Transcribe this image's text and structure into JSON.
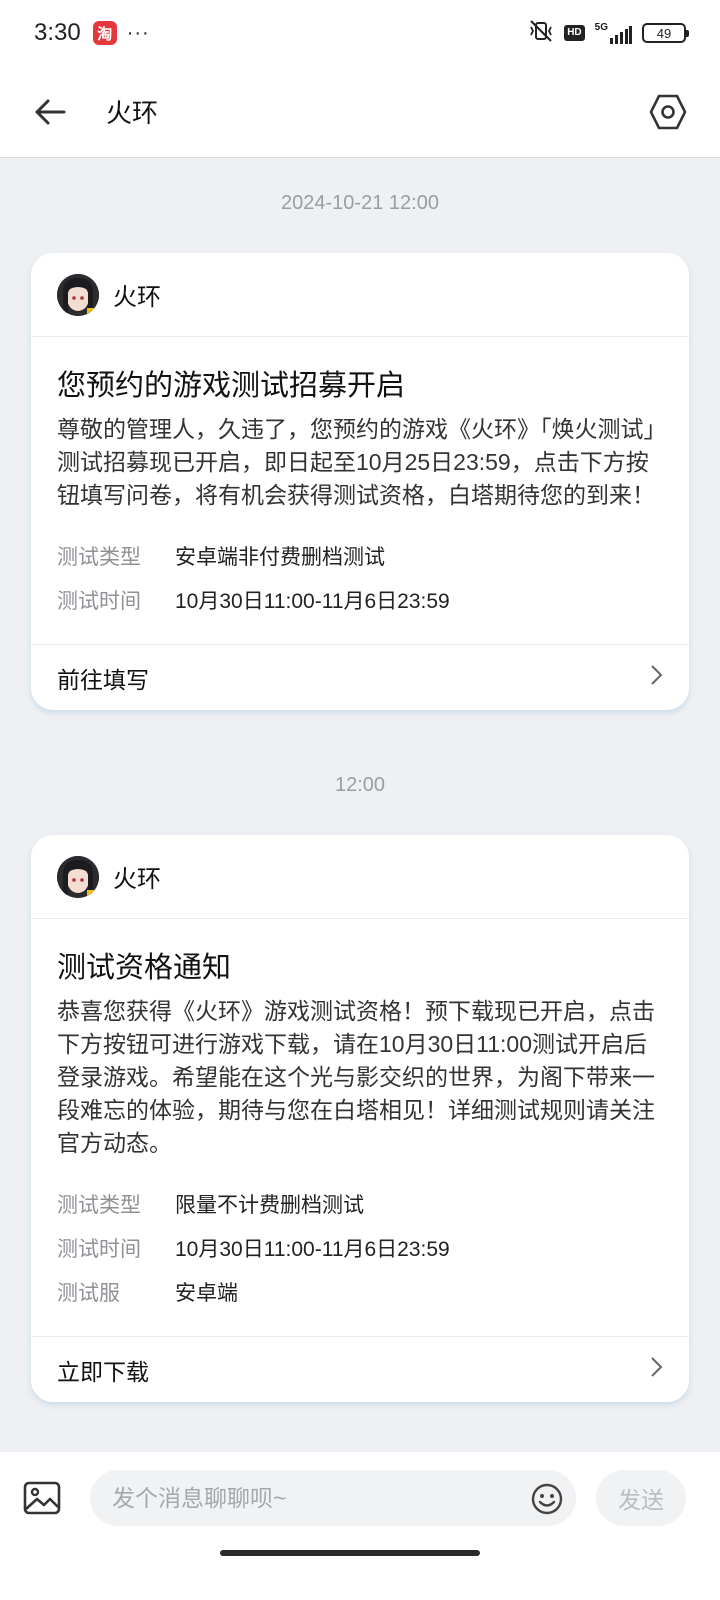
{
  "status_bar": {
    "time": "3:30",
    "taobao_label": "淘",
    "more_dots": "···",
    "hd_label": "HD",
    "network_label": "5G",
    "battery_level": "49"
  },
  "header": {
    "title": "火环",
    "back_icon": "arrow-left-icon",
    "settings_icon": "hexagon-settings-icon"
  },
  "messages": [
    {
      "timestamp": "2024-10-21 12:00",
      "sender": "火环",
      "title": "您预约的游戏测试招募开启",
      "body": "尊敬的管理人，久违了，您预约的游戏《火环》「焕火测试」测试招募现已开启，即日起至10月25日23:59，点击下方按钮填写问卷，将有机会获得测试资格，白塔期待您的到来！",
      "meta": [
        {
          "key": "测试类型",
          "value": "安卓端非付费删档测试"
        },
        {
          "key": "测试时间",
          "value": "10月30日11:00-11月6日23:59"
        }
      ],
      "action": "前往填写"
    },
    {
      "timestamp": "12:00",
      "sender": "火环",
      "title": "测试资格通知",
      "body": "恭喜您获得《火环》游戏测试资格！预下载现已开启，点击下方按钮可进行游戏下载，请在10月30日11:00测试开启后登录游戏。希望能在这个光与影交织的世界，为阁下带来一段难忘的体验，期待与您在白塔相见！详细测试规则请关注官方动态。",
      "meta": [
        {
          "key": "测试类型",
          "value": "限量不计费删档测试"
        },
        {
          "key": "测试时间",
          "value": "10月30日11:00-11月6日23:59"
        },
        {
          "key": "测试服",
          "value": "安卓端"
        }
      ],
      "action": "立即下载"
    }
  ],
  "input_bar": {
    "placeholder": "发个消息聊聊呗~",
    "value": "",
    "send_label": "发送",
    "image_icon": "image-icon",
    "emoji_icon": "emoji-icon"
  },
  "colors": {
    "background": "#eef0f3",
    "card": "#ffffff",
    "muted_text": "#9a9da3",
    "taobao_red": "#e4393c"
  }
}
